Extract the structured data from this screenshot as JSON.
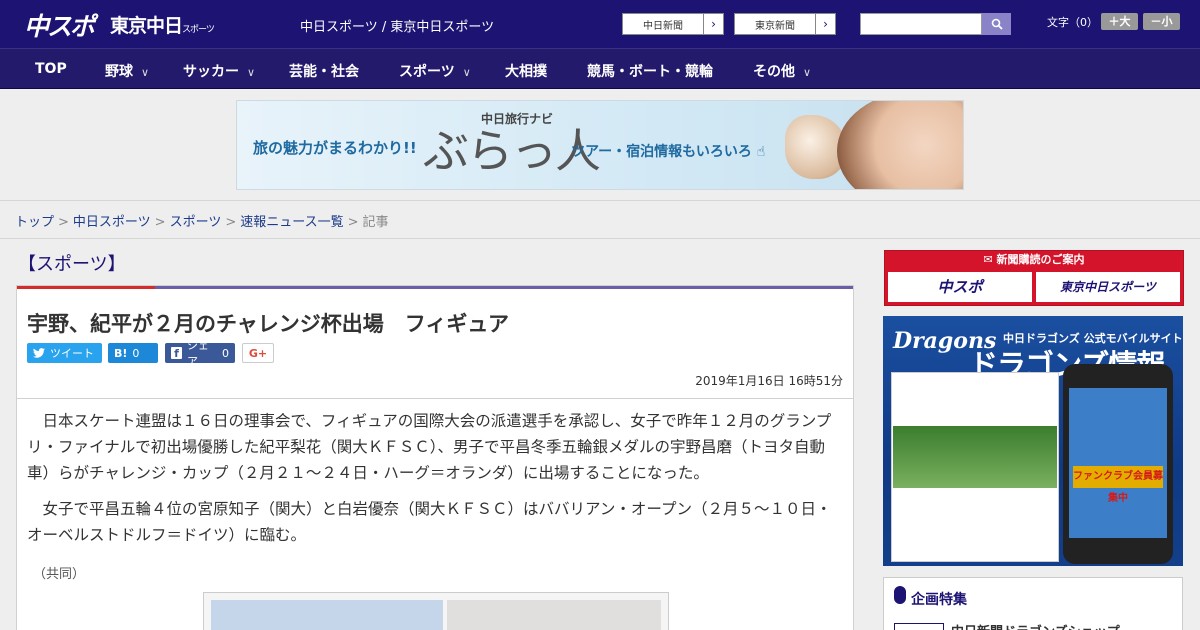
{
  "header": {
    "logo_main": "中スポ",
    "logo_tokyo": "東京中日",
    "logo_tokyo_suffix": "スポーツ",
    "site_title": "中日スポーツ / 東京中日スポーツ",
    "paper_buttons": [
      "中日新聞",
      "東京新聞"
    ],
    "font_size_label": "文字（0）",
    "font_larger": "＋大",
    "font_smaller": "－小"
  },
  "nav": {
    "items": [
      {
        "label": "TOP",
        "chevron": false
      },
      {
        "label": "野球",
        "chevron": true
      },
      {
        "label": "サッカー",
        "chevron": true
      },
      {
        "label": "芸能・社会",
        "chevron": false
      },
      {
        "label": "スポーツ",
        "chevron": true
      },
      {
        "label": "大相撲",
        "chevron": false
      },
      {
        "label": "競馬・ボート・競輪",
        "chevron": false
      },
      {
        "label": "その他",
        "chevron": true
      }
    ]
  },
  "banner": {
    "left_text": "旅の魅力がまるわかり!!",
    "navi_label": "中日旅行ナビ",
    "big_text": "ぶらっ人",
    "right_text": "ツアー・宿泊情報もいろいろ"
  },
  "breadcrumb": {
    "links": [
      "トップ",
      "中日スポーツ",
      "スポーツ",
      "速報ニュース一覧"
    ],
    "current": "記事",
    "separator": ">"
  },
  "article": {
    "section": "【スポーツ】",
    "headline": "宇野、紀平が２月のチャレンジ杯出場　フィギュア",
    "share": {
      "tweet": "ツイート",
      "hatena_icon": "B!",
      "hatena_count": "0",
      "facebook_icon": "f",
      "facebook_label": "シェア",
      "facebook_count": "0",
      "gplus": "G+"
    },
    "date": "2019年1月16日 16時51分",
    "paragraphs": [
      "　日本スケート連盟は１６日の理事会で、フィギュアの国際大会の派遣選手を承認し、女子で昨年１２月のグランプリ・ファイナルで初出場優勝した紀平梨花（関大ＫＦＳＣ）、男子で平昌冬季五輪銀メダルの宇野昌磨（トヨタ自動車）らがチャレンジ・カップ（２月２１～２４日・ハーグ＝オランダ）に出場することになった。",
      "　女子で平昌五輪４位の宮原知子（関大）と白岩優奈（関大ＫＦＳＣ）はババリアン・オープン（２月５～１０日・オーベルストドルフ＝ドイツ）に臨む。"
    ],
    "credit": "（共同）"
  },
  "sidebar": {
    "subscribe_header": "新聞購読のご案内",
    "subscribe_logos": [
      "中スポ",
      "東京中日スポーツ"
    ],
    "dragons_ad": {
      "logo": "Dragons",
      "subtitle": "中日ドラゴンズ 公式モバイルサイト",
      "title": "ドラゴンズ情報",
      "phone_banner": "ファンクラブ会員募集中"
    },
    "feature_title": "企画特集",
    "feature_item": "中日新聞ドラゴンズショップ"
  },
  "colors": {
    "header_bg": "#1c1373",
    "nav_bg": "#241a6c",
    "accent_red": "#d42b2b",
    "accent_purple": "#6b5ea8"
  }
}
